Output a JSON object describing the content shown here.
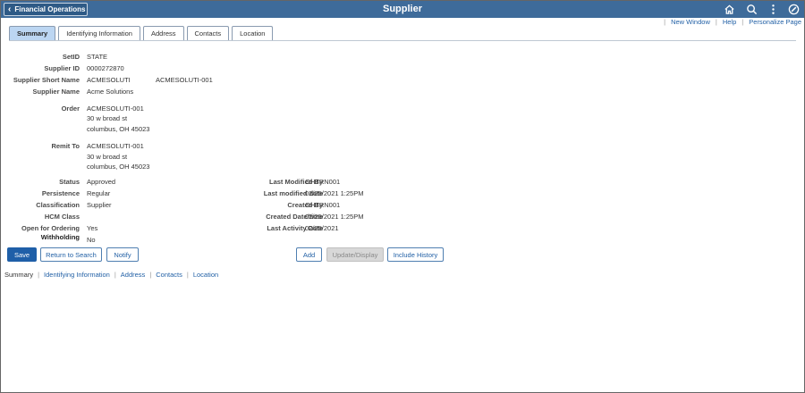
{
  "banner": {
    "back_label": "Financial Operations",
    "title": "Supplier",
    "icons": [
      "home-icon",
      "search-icon",
      "more-vertical-icon",
      "navbar-compass-icon"
    ]
  },
  "toplinks": {
    "new_window": "New Window",
    "help": "Help",
    "personalize": "Personalize Page"
  },
  "tabs": [
    {
      "label": "Summary",
      "active": true
    },
    {
      "label": "Identifying Information",
      "active": false
    },
    {
      "label": "Address",
      "active": false
    },
    {
      "label": "Contacts",
      "active": false
    },
    {
      "label": "Location",
      "active": false
    }
  ],
  "fields": {
    "setid": {
      "label": "SetID",
      "value": "STATE"
    },
    "supplier_id": {
      "label": "Supplier ID",
      "value": "0000272870"
    },
    "short_name": {
      "label": "Supplier Short Name",
      "value": "ACMESOLUTI",
      "extra": "ACMESOLUTI-001"
    },
    "supplier_name": {
      "label": "Supplier Name",
      "value": "Acme Solutions"
    },
    "order": {
      "label": "Order",
      "line1": "ACMESOLUTI-001",
      "line2": "30 w broad st",
      "line3": "columbus, OH  45023"
    },
    "remit_to": {
      "label": "Remit To",
      "line1": "ACMESOLUTI-001",
      "line2": "30 w broad st",
      "line3": "columbus, OH  45023"
    },
    "status": {
      "label": "Status",
      "value": "Approved"
    },
    "persistence": {
      "label": "Persistence",
      "value": "Regular"
    },
    "classification": {
      "label": "Classification",
      "value": "Supplier"
    },
    "hcm_class": {
      "label": "HCM Class",
      "value": ""
    },
    "open_for_ordering": {
      "label": "Open for Ordering",
      "value": "Yes"
    },
    "withholding": {
      "label": "Withholding",
      "value": "No"
    },
    "last_modified_by": {
      "label": "Last Modified By",
      "value": "OHTRN001"
    },
    "last_modified_date": {
      "label": "Last modified date",
      "value": "02/25/2021  1:25PM"
    },
    "created_by": {
      "label": "Created By",
      "value": "OHTRN001"
    },
    "created_datetime": {
      "label": "Created Date/time",
      "value": "02/25/2021  1:25PM"
    },
    "last_activity_date": {
      "label": "Last Activity Date",
      "value": "02/25/2021"
    }
  },
  "buttons": {
    "save": "Save",
    "return_to_search": "Return to Search",
    "notify": "Notify",
    "add": "Add",
    "update_display": "Update/Display",
    "include_history": "Include History"
  },
  "footer_links": [
    "Summary",
    "Identifying Information",
    "Address",
    "Contacts",
    "Location"
  ],
  "colors": {
    "banner": "#3e6b9a",
    "link": "#2361a6",
    "primary_button": "#1f5fa8",
    "active_tab": "#bcd6f2"
  }
}
